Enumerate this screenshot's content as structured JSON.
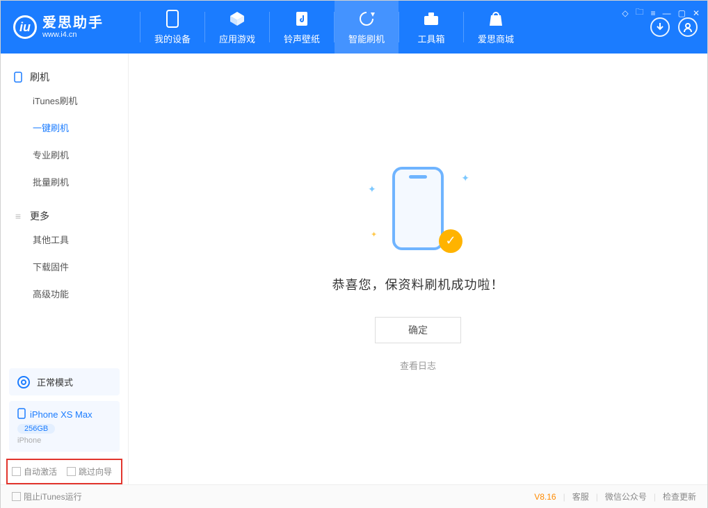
{
  "app": {
    "name_cn": "爱思助手",
    "url": "www.i4.cn"
  },
  "nav": {
    "items": [
      {
        "label": "我的设备"
      },
      {
        "label": "应用游戏"
      },
      {
        "label": "铃声壁纸"
      },
      {
        "label": "智能刷机"
      },
      {
        "label": "工具箱"
      },
      {
        "label": "爱思商城"
      }
    ]
  },
  "sidebar": {
    "group1": {
      "title": "刷机",
      "items": [
        {
          "label": "iTunes刷机"
        },
        {
          "label": "一键刷机"
        },
        {
          "label": "专业刷机"
        },
        {
          "label": "批量刷机"
        }
      ]
    },
    "group2": {
      "title": "更多",
      "items": [
        {
          "label": "其他工具"
        },
        {
          "label": "下载固件"
        },
        {
          "label": "高级功能"
        }
      ]
    },
    "mode": {
      "label": "正常模式"
    },
    "device": {
      "name": "iPhone XS Max",
      "capacity": "256GB",
      "type": "iPhone"
    },
    "options": {
      "auto_activate": "自动激活",
      "skip_guide": "跳过向导"
    }
  },
  "main": {
    "message": "恭喜您，保资料刷机成功啦！",
    "ok": "确定",
    "log": "查看日志"
  },
  "footer": {
    "block_itunes": "阻止iTunes运行",
    "version": "V8.16",
    "links": {
      "support": "客服",
      "wechat": "微信公众号",
      "update": "检查更新"
    }
  }
}
